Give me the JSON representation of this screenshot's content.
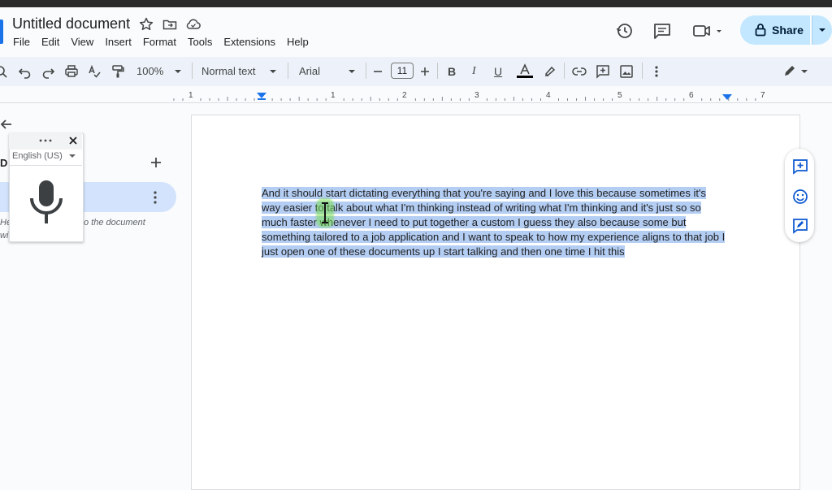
{
  "document": {
    "title": "Untitled document",
    "body_text": "And it should start dictating everything that you're saying and I love this because sometimes it's way easier to talk about what I'm thinking instead of writing what I'm thinking and it's just so so much faster whenever I need to put together a custom I guess they also because some but something tailored to a job application and I want to speak to how my experience aligns to that job I just open one of these documents up I start talking and then one time I hit this"
  },
  "menu": [
    "File",
    "Edit",
    "View",
    "Insert",
    "Format",
    "Tools",
    "Extensions",
    "Help"
  ],
  "header": {
    "share_label": "Share"
  },
  "toolbar": {
    "zoom": "100%",
    "style": "Normal text",
    "font": "Arial",
    "font_size": "11"
  },
  "ruler": {
    "ticks": [
      "1",
      "1",
      "2",
      "3",
      "4",
      "5",
      "6",
      "7"
    ]
  },
  "sidebar": {
    "heading_fragment": "D",
    "hint_line1": "He",
    "hint_line1_b": "o the document",
    "hint_line2": "wi"
  },
  "voice_typing": {
    "language": "English (US)"
  },
  "colors": {
    "accent": "#1a73e8",
    "share_bg": "#c2e7ff",
    "selection": "#b3cdf3",
    "sidebar_active": "#d3e3fd"
  }
}
